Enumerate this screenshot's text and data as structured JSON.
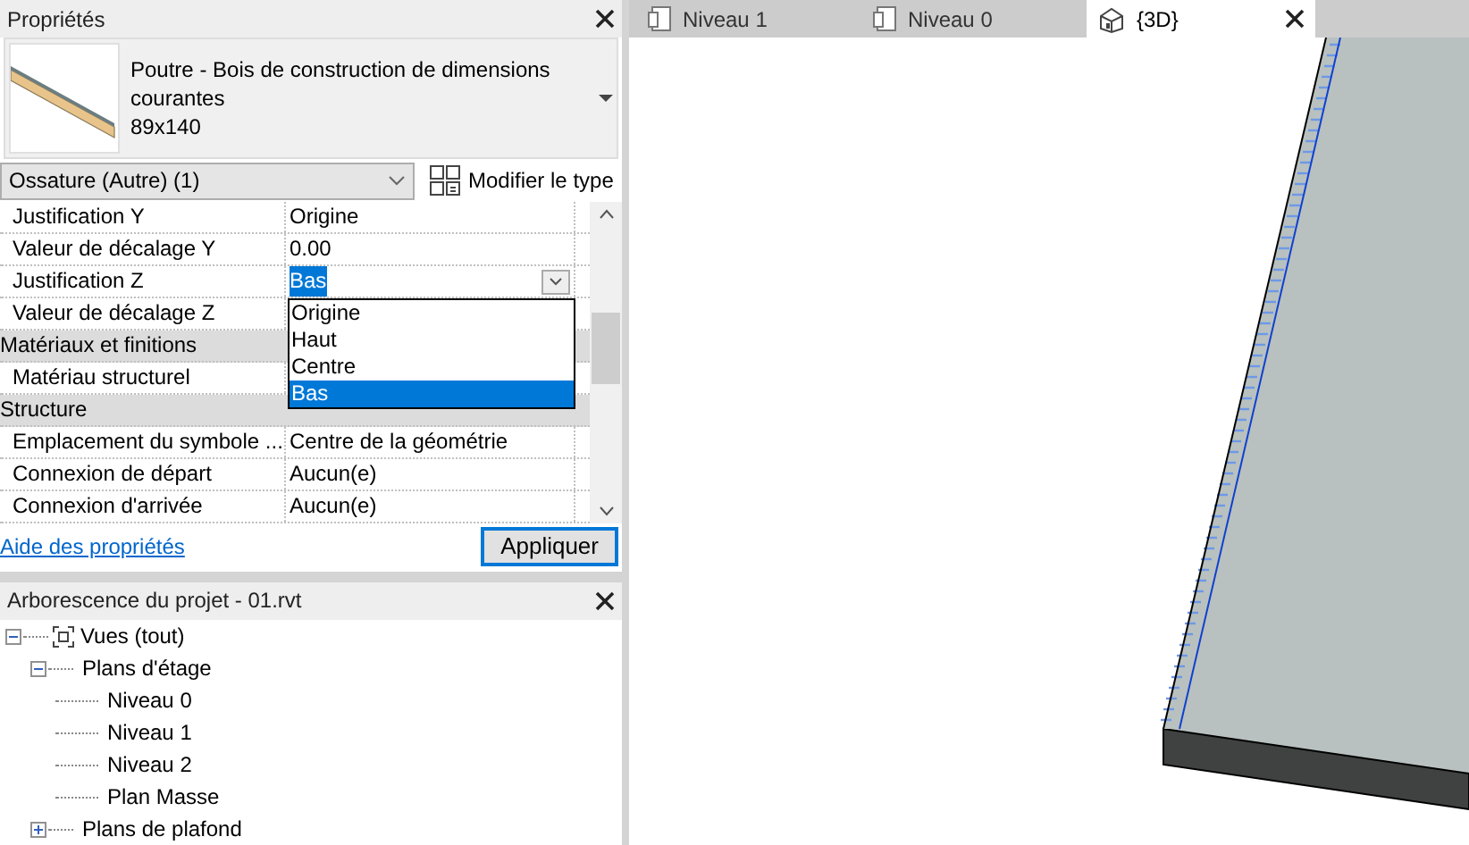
{
  "properties_panel": {
    "title": "Propriétés",
    "type_selector": {
      "family": "Poutre - Bois de construction de dimensions courantes",
      "type": "89x140"
    },
    "instance_filter": "Ossature (Autre) (1)",
    "edit_type_button": "Modifier le type",
    "rows": [
      {
        "kind": "param",
        "label": "Justification Y",
        "value": "Origine"
      },
      {
        "kind": "param",
        "label": "Valeur de décalage Y",
        "value": "0.00"
      },
      {
        "kind": "param",
        "label": "Justification Z",
        "value": "Bas",
        "editing": true
      },
      {
        "kind": "param",
        "label": "Valeur de décalage Z"
      },
      {
        "kind": "group",
        "label": "Matériaux et finitions"
      },
      {
        "kind": "param",
        "label": "Matériau structurel"
      },
      {
        "kind": "group",
        "label": "Structure"
      },
      {
        "kind": "param",
        "label": "Emplacement du symbole ...",
        "value": "Centre de la géométrie"
      },
      {
        "kind": "param",
        "label": "Connexion de départ",
        "value": "Aucun(e)"
      },
      {
        "kind": "param",
        "label": "Connexion d'arrivée",
        "value": "Aucun(e)"
      }
    ],
    "dropdown_options": [
      {
        "label": "Origine",
        "selected": false
      },
      {
        "label": "Haut",
        "selected": false
      },
      {
        "label": "Centre",
        "selected": false
      },
      {
        "label": "Bas",
        "selected": true
      }
    ],
    "help_link": "Aide des propriétés",
    "apply_button": "Appliquer"
  },
  "project_browser": {
    "title": "Arborescence du projet - 01.rvt",
    "tree": [
      {
        "label": "Vues (tout)",
        "expanded": true,
        "children": [
          {
            "label": "Plans d'étage",
            "expanded": true,
            "children": [
              {
                "label": "Niveau 0"
              },
              {
                "label": "Niveau 1"
              },
              {
                "label": "Niveau 2"
              },
              {
                "label": "Plan Masse"
              }
            ]
          },
          {
            "label": "Plans de plafond",
            "expanded": false
          }
        ]
      }
    ]
  },
  "view_tabs": [
    {
      "label": "Niveau 1",
      "kind": "plan",
      "selected": false
    },
    {
      "label": "Niveau 0",
      "kind": "plan",
      "selected": false
    },
    {
      "label": "{3D}",
      "kind": "model",
      "selected": true
    }
  ]
}
